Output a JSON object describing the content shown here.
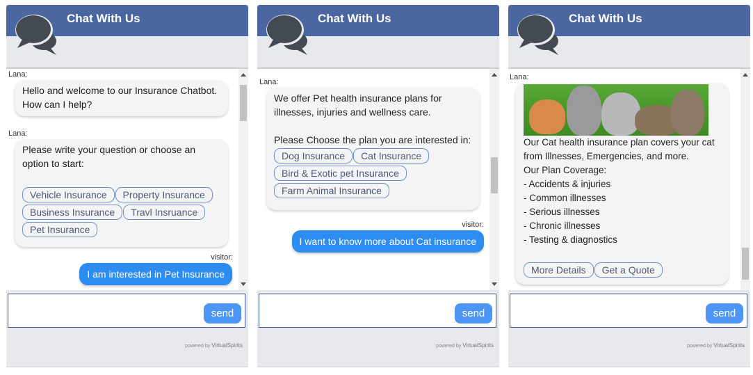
{
  "header": {
    "title": "Chat With Us",
    "logo_icon": "speech-bubbles-icon"
  },
  "footer": {
    "powered_prefix": "powered by",
    "powered_brand": "VirtualSpirits"
  },
  "input": {
    "value": "",
    "placeholder": "",
    "send_label": "send"
  },
  "panels": [
    {
      "messages": [
        {
          "sender": "Lana:",
          "lines": [
            "Hello and welcome to our Insurance Chatbot.",
            "How can I help?"
          ]
        },
        {
          "sender": "Lana:",
          "lines": [
            "Please write your question or choose an",
            "option to start:"
          ],
          "options": [
            "Vehicle Insurance",
            "Property Insurance",
            "Business Insurance",
            "Travl Insruance",
            "Pet Insurance"
          ]
        },
        {
          "sender": "visitor:",
          "text": "I am interested in Pet Insurance"
        }
      ]
    },
    {
      "messages": [
        {
          "sender": "Lana:",
          "lines": [
            "We offer Pet health insurance plans for",
            "illnesses, injuries and wellness care.",
            "",
            "Please Choose the plan you are interested in:"
          ],
          "options": [
            "Dog Insurance",
            "Cat Insurance",
            "Bird & Exotic pet Insurance",
            "Farm Animal Insurance"
          ]
        },
        {
          "sender": "visitor:",
          "text": "I want to know more about Cat insurance"
        }
      ]
    },
    {
      "messages": [
        {
          "sender": "Lana:",
          "image": "kittens-on-grass-image",
          "lines": [
            "Our Cat health insurance plan covers your cat",
            "from Illnesses, Emergencies, and more.",
            "Our Plan Coverage:",
            "- Accidents & injuries",
            "- Common illnesses",
            "- Serious illnesses",
            "- Chronic illnesses",
            "- Testing & diagnostics"
          ],
          "options": [
            "More Details",
            "Get a Quote"
          ]
        }
      ]
    }
  ],
  "colors": {
    "header": "#4a67a1",
    "visitor_bubble": "#2d8cf0",
    "send_button": "#4e96f5",
    "option_border": "#6d8fd0"
  }
}
